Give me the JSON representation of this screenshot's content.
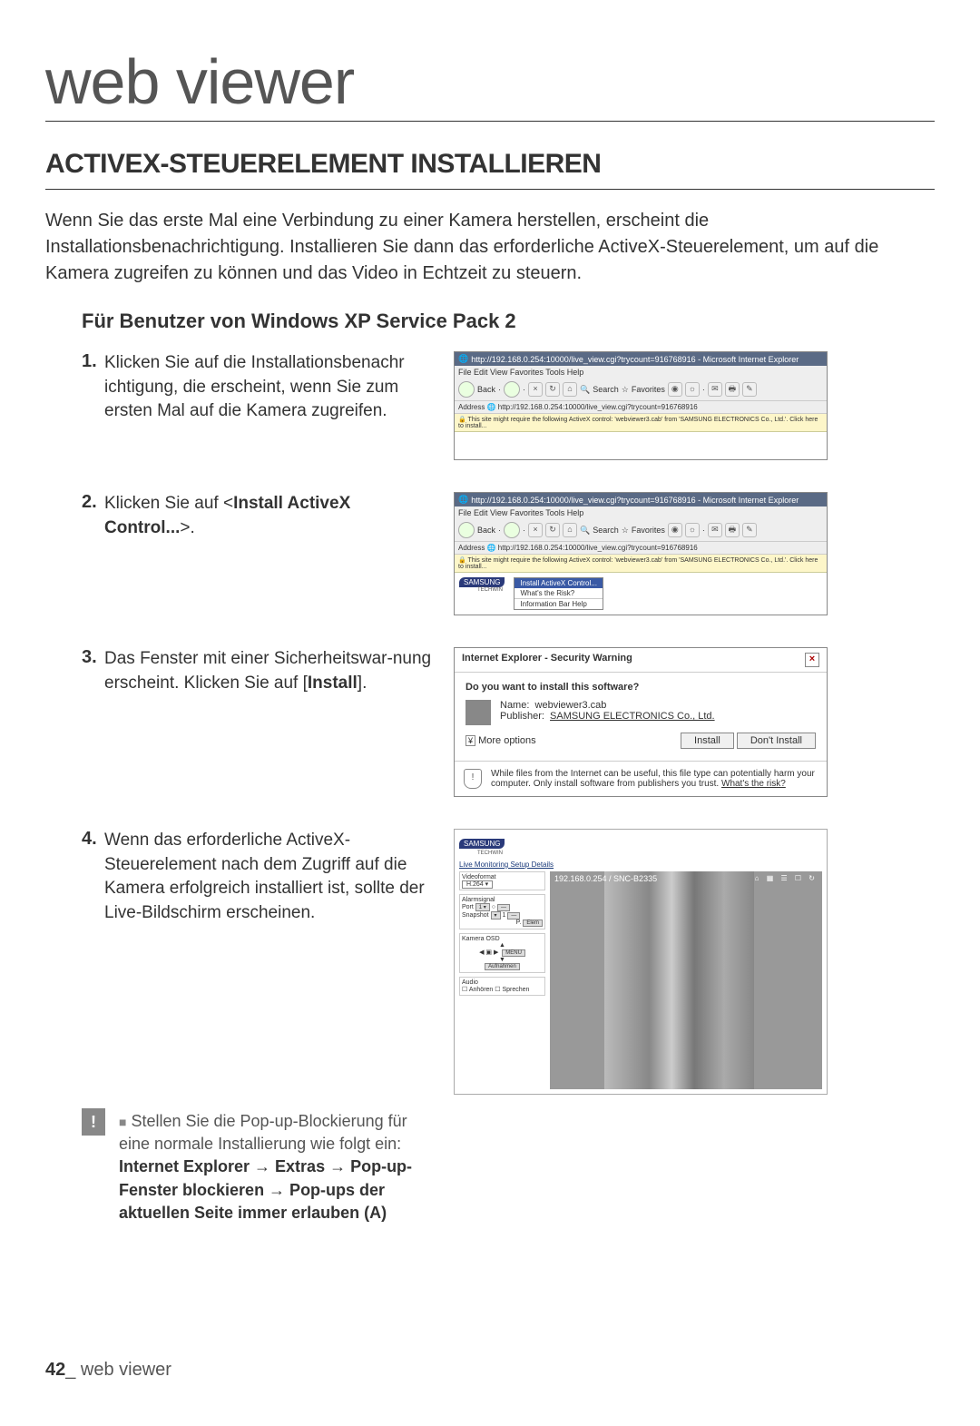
{
  "page": {
    "main_title": "web viewer",
    "section_title": "ACTIVEX-STEUERELEMENT INSTALLIEREN",
    "intro": "Wenn Sie das erste Mal eine Verbindung zu einer Kamera herstellen, erscheint die Installationsbenachrichtigung. Installieren Sie dann das erforderliche ActiveX-Steuerelement, um auf die Kamera zugreifen zu können und das Video in Echtzeit zu steuern.",
    "sub_title": "Für Benutzer von Windows XP Service Pack 2",
    "footer_num": "42",
    "footer_label": "_ web viewer"
  },
  "steps": {
    "s1": {
      "num": "1.",
      "text": "Klicken Sie auf die Installationsbenachr ichtigung, die erscheint, wenn Sie zum ersten Mal auf die Kamera zugreifen."
    },
    "s2": {
      "num": "2.",
      "pre": "Klicken Sie auf <",
      "bold": "Install ActiveX Control...",
      "post": ">."
    },
    "s3": {
      "num": "3.",
      "pre": "Das Fenster mit einer Sicherheitswar-nung erscheint. Klicken Sie auf [",
      "bold": "Install",
      "post": "]."
    },
    "s4": {
      "num": "4.",
      "text": "Wenn das erforderliche ActiveX-Steuerelement nach dem Zugriff auf die Kamera erfolgreich installiert ist, sollte der Live-Bildschirm erscheinen."
    }
  },
  "note": {
    "badge": "!",
    "pre": "Stellen Sie die Pop-up-Blockierung für eine normale Installierung wie folgt ein:",
    "path": "Internet Explorer → Extras → Pop-up-Fenster blockieren → Pop-ups der aktuellen Seite immer erlauben (A)"
  },
  "ie": {
    "title_url": "http://192.168.0.254:10000/live_view.cgi?trycount=916768916 - Microsoft Internet Explorer",
    "menus": "File   Edit   View   Favorites   Tools   Help",
    "tb_back": "Back",
    "tb_search": "Search",
    "tb_fav": "Favorites",
    "addr_label": "Address",
    "addr_val": "http://192.168.0.254:10000/live_view.cgi?trycount=916768916",
    "infobar": "This site might require the following ActiveX control: 'webviewer3.cab' from 'SAMSUNG ELECTRONICS Co., Ltd.'. Click here to install...",
    "ctx_install": "Install ActiveX Control...",
    "ctx_risk": "What's the Risk?",
    "ctx_help": "Information Bar Help",
    "samsung": "SAMSUNG",
    "samsung_sub": "TECHWIN"
  },
  "sw": {
    "title": "Internet Explorer - Security Warning",
    "close": "×",
    "q": "Do you want to install this software?",
    "name_l": "Name:",
    "name_v": "webviewer3.cab",
    "pub_l": "Publisher:",
    "pub_v": "SAMSUNG ELECTRONICS Co., Ltd.",
    "more": "More options",
    "more_chev": "¥",
    "install": "Install",
    "dont": "Don't Install",
    "shield": "!",
    "foot": "While files from the Internet can be useful, this file type can potentially harm your computer. Only install software from publishers you trust. ",
    "risk": "What's the risk?"
  },
  "cam": {
    "samsung": "SAMSUNG",
    "sub": "TECHWIN",
    "tabs": "Live   Monitoring   Setup   Details",
    "vf_label": "Videoformat",
    "vf_val": "H.264",
    "alarm": "Alarmsignal",
    "port": "Port",
    "snap": "Snapshot",
    "elem": "Elem",
    "osd_label": "Kamera OSD",
    "menu_btn": "MENU",
    "setup_btn": "Aufnahmen",
    "audio": "Audio",
    "listen": "Anhören",
    "speak": "Sprechen",
    "cap": "192.168.0.254 / SNC-B2335",
    "icons": "⌂ ▦ ☰ ☐ ↻"
  }
}
